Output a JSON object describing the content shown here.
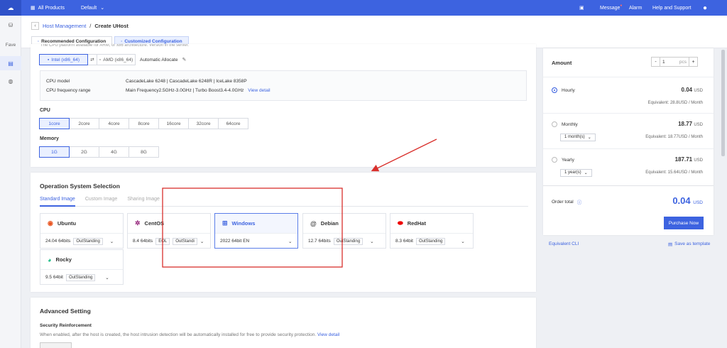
{
  "topbar": {
    "products_label": "All Products",
    "region_label": "Default",
    "message": "Message",
    "alarm": "Alarm",
    "help": "Help and Support"
  },
  "sidebar": {
    "fave_label": "Fave"
  },
  "header": {
    "breadcrumb_parent": "Host Management",
    "breadcrumb_sep": "/",
    "breadcrumb_current": "Create UHost",
    "tab_recommended": "Recommended Configuration",
    "tab_customized": "Customized Configuration"
  },
  "cpu_section": {
    "clipped_text": "The CPU platform available for ARM, or x86 architecture. Version in the server.",
    "arch_intel": "Intel (x86_64)",
    "arch_amd": "AMD (x86_64)",
    "auto_allocate": "Automatic Allocate",
    "cpu_model_label": "CPU model",
    "cpu_model_value": "CascadeLake 6248 | CascadeLake 6248R | IceLake 8358P",
    "cpu_freq_label": "CPU frequency range",
    "cpu_freq_value": "Main Frequency2.5GHz-3.0GHz | Turbo Boost3.4-4.0GHz",
    "view_detail": "View detail",
    "cpu_label": "CPU",
    "cpu_options": [
      "1core",
      "2core",
      "4core",
      "8core",
      "16core",
      "32core",
      "64core"
    ],
    "memory_label": "Memory",
    "memory_options": [
      "1G",
      "2G",
      "4G",
      "8G"
    ]
  },
  "os_section": {
    "title": "Operation System Selection",
    "tabs": [
      "Standard Image",
      "Custom Image",
      "Sharing Image"
    ],
    "cards": [
      {
        "name": "Ubuntu",
        "version": "24.04 64bits",
        "badge": "OutStanding"
      },
      {
        "name": "CentOS",
        "version": "8.4 64bits",
        "badge": "EOL",
        "badge2": "OutStandi"
      },
      {
        "name": "Windows",
        "version": "2022 64bit EN"
      },
      {
        "name": "Debian",
        "version": "12.7 64bits",
        "badge": "OutStanding"
      },
      {
        "name": "RedHat",
        "version": "8.3 64bit",
        "badge": "OutStanding"
      },
      {
        "name": "Rocky",
        "version": "9.5 64bit",
        "badge": "OutStanding"
      }
    ]
  },
  "advanced": {
    "title": "Advanced Setting",
    "security_label": "Security Reinforcement",
    "security_desc": "When enabled, after the host is created, the host intrusion detection will be automatically installed for free to provide security protection.",
    "view_detail": "View detail"
  },
  "order": {
    "amount_label": "Amount",
    "amount_value": "1",
    "amount_unit": "pcs",
    "minus": "-",
    "plus": "+",
    "hourly": {
      "label": "Hourly",
      "price": "0.04",
      "currency": "USD",
      "equiv": "Equivalent: 28.8USD / Month"
    },
    "monthly": {
      "label": "Monthly",
      "select": "1 month(s)",
      "price": "18.77",
      "currency": "USD",
      "equiv": "Equivalent: 18.77USD / Month"
    },
    "yearly": {
      "label": "Yearly",
      "select": "1 year(s)",
      "price": "187.71",
      "currency": "USD",
      "equiv": "Equivalent: 15.64USD / Month"
    },
    "total_label": "Order total",
    "total_price": "0.04",
    "total_currency": "USD",
    "purchase": "Purchase Now",
    "cli": "Equivalent CLI",
    "save_template": "Save as template"
  },
  "colors": {
    "brand": "#3d63e0",
    "annotation": "#d9302c"
  }
}
